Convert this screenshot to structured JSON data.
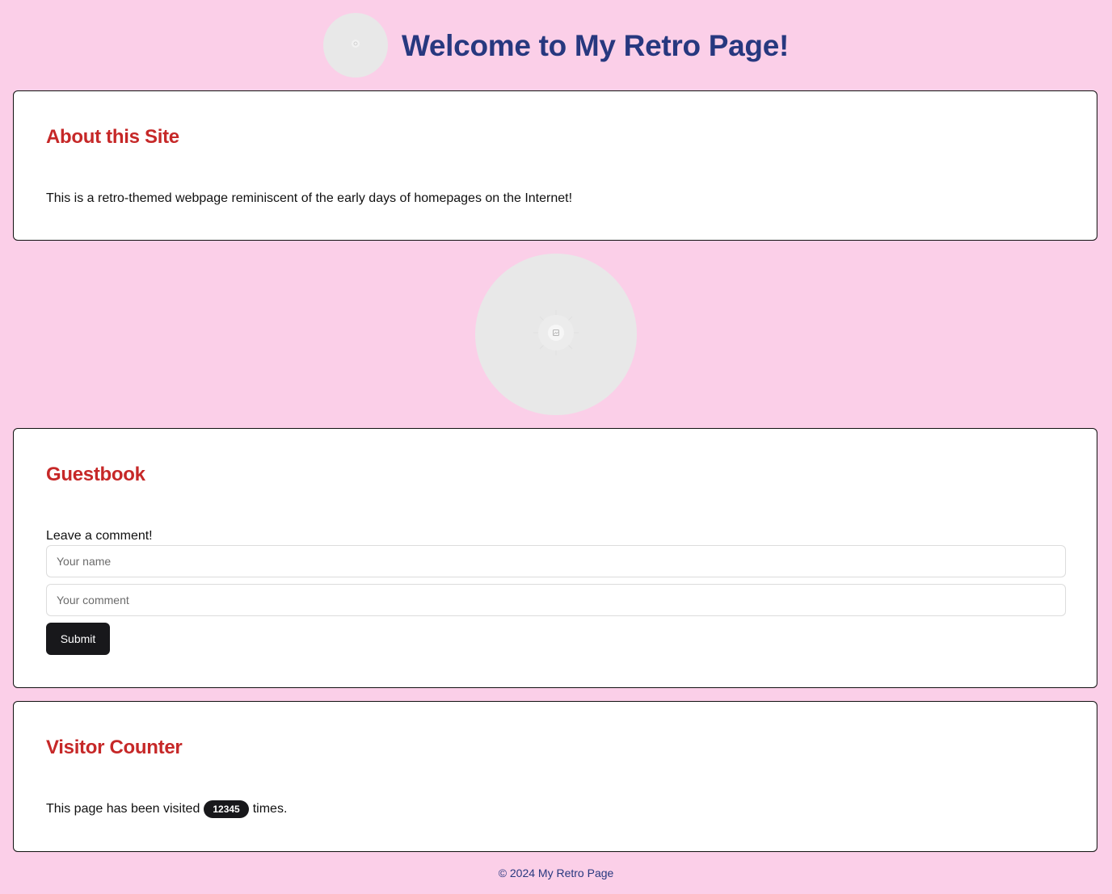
{
  "header": {
    "avatar_icon": "image-placeholder-icon",
    "title": "Welcome to My Retro Page!"
  },
  "about": {
    "title": "About this Site",
    "text": "This is a retro-themed webpage reminiscent of the early days of homepages on the Internet!"
  },
  "hero": {
    "icon": "image-placeholder-icon"
  },
  "guestbook": {
    "title": "Guestbook",
    "prompt": "Leave a comment!",
    "name_placeholder": "Your name",
    "name_value": "",
    "comment_placeholder": "Your comment",
    "comment_value": "",
    "submit_label": "Submit"
  },
  "counter": {
    "title": "Visitor Counter",
    "text_before": "This page has been visited",
    "count": "12345",
    "text_after": "times."
  },
  "footer": {
    "text": "© 2024 My Retro Page"
  },
  "colors": {
    "background": "#fbcfe8",
    "title": "#27387f",
    "heading": "#c62828",
    "button": "#18181b",
    "placeholder_circle": "#e8e8e8"
  }
}
